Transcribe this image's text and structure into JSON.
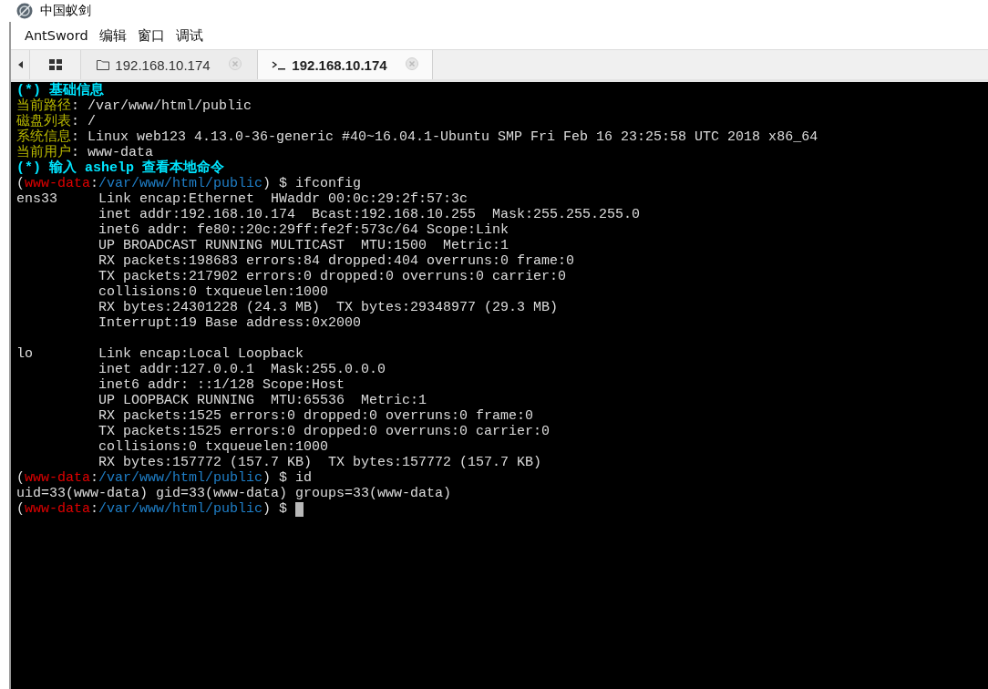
{
  "window": {
    "title": "中国蚁剑"
  },
  "menu": [
    "AntSword",
    "编辑",
    "窗口",
    "调试"
  ],
  "tabs": [
    {
      "kind": "files",
      "label": "192.168.10.174",
      "selected": false
    },
    {
      "kind": "terminal",
      "label": "192.168.10.174",
      "selected": true
    }
  ],
  "terminal": {
    "lines": [
      {
        "cursor": false,
        "segments": [
          {
            "kind": "heading",
            "text": "(*) 基础信息"
          }
        ]
      },
      {
        "cursor": false,
        "segments": [
          {
            "kind": "label",
            "text": "当前路径"
          },
          {
            "kind": "plain",
            "text": ": /var/www/html/public"
          }
        ]
      },
      {
        "cursor": false,
        "segments": [
          {
            "kind": "label",
            "text": "磁盘列表"
          },
          {
            "kind": "plain",
            "text": ": /"
          }
        ]
      },
      {
        "cursor": false,
        "segments": [
          {
            "kind": "label",
            "text": "系统信息"
          },
          {
            "kind": "plain",
            "text": ": Linux web123 4.13.0-36-generic #40~16.04.1-Ubuntu SMP Fri Feb 16 23:25:58 UTC 2018 x86_64"
          }
        ]
      },
      {
        "cursor": false,
        "segments": [
          {
            "kind": "label",
            "text": "当前用户"
          },
          {
            "kind": "plain",
            "text": ": www-data"
          }
        ]
      },
      {
        "cursor": false,
        "segments": [
          {
            "kind": "heading",
            "text": "(*) 输入 ashelp 查看本地命令"
          }
        ]
      },
      {
        "cursor": false,
        "segments": [
          {
            "kind": "plain",
            "text": "("
          },
          {
            "kind": "user",
            "text": "www-data"
          },
          {
            "kind": "plain",
            "text": ":"
          },
          {
            "kind": "path",
            "text": "/var/www/html/public"
          },
          {
            "kind": "plain",
            "text": ") $ ifconfig"
          }
        ]
      },
      {
        "cursor": false,
        "segments": [
          {
            "kind": "plain",
            "text": "ens33     Link encap:Ethernet  HWaddr 00:0c:29:2f:57:3c"
          }
        ]
      },
      {
        "cursor": false,
        "segments": [
          {
            "kind": "plain",
            "text": "          inet addr:192.168.10.174  Bcast:192.168.10.255  Mask:255.255.255.0"
          }
        ]
      },
      {
        "cursor": false,
        "segments": [
          {
            "kind": "plain",
            "text": "          inet6 addr: fe80::20c:29ff:fe2f:573c/64 Scope:Link"
          }
        ]
      },
      {
        "cursor": false,
        "segments": [
          {
            "kind": "plain",
            "text": "          UP BROADCAST RUNNING MULTICAST  MTU:1500  Metric:1"
          }
        ]
      },
      {
        "cursor": false,
        "segments": [
          {
            "kind": "plain",
            "text": "          RX packets:198683 errors:84 dropped:404 overruns:0 frame:0"
          }
        ]
      },
      {
        "cursor": false,
        "segments": [
          {
            "kind": "plain",
            "text": "          TX packets:217902 errors:0 dropped:0 overruns:0 carrier:0"
          }
        ]
      },
      {
        "cursor": false,
        "segments": [
          {
            "kind": "plain",
            "text": "          collisions:0 txqueuelen:1000"
          }
        ]
      },
      {
        "cursor": false,
        "segments": [
          {
            "kind": "plain",
            "text": "          RX bytes:24301228 (24.3 MB)  TX bytes:29348977 (29.3 MB)"
          }
        ]
      },
      {
        "cursor": false,
        "segments": [
          {
            "kind": "plain",
            "text": "          Interrupt:19 Base address:0x2000"
          }
        ]
      },
      {
        "cursor": false
      },
      {
        "cursor": false,
        "segments": [
          {
            "kind": "plain",
            "text": "lo        Link encap:Local Loopback"
          }
        ]
      },
      {
        "cursor": false,
        "segments": [
          {
            "kind": "plain",
            "text": "          inet addr:127.0.0.1  Mask:255.0.0.0"
          }
        ]
      },
      {
        "cursor": false,
        "segments": [
          {
            "kind": "plain",
            "text": "          inet6 addr: ::1/128 Scope:Host"
          }
        ]
      },
      {
        "cursor": false,
        "segments": [
          {
            "kind": "plain",
            "text": "          UP LOOPBACK RUNNING  MTU:65536  Metric:1"
          }
        ]
      },
      {
        "cursor": false,
        "segments": [
          {
            "kind": "plain",
            "text": "          RX packets:1525 errors:0 dropped:0 overruns:0 frame:0"
          }
        ]
      },
      {
        "cursor": false,
        "segments": [
          {
            "kind": "plain",
            "text": "          TX packets:1525 errors:0 dropped:0 overruns:0 carrier:0"
          }
        ]
      },
      {
        "cursor": false,
        "segments": [
          {
            "kind": "plain",
            "text": "          collisions:0 txqueuelen:1000"
          }
        ]
      },
      {
        "cursor": false,
        "segments": [
          {
            "kind": "plain",
            "text": "          RX bytes:157772 (157.7 KB)  TX bytes:157772 (157.7 KB)"
          }
        ]
      },
      {
        "cursor": false,
        "segments": [
          {
            "kind": "plain",
            "text": "("
          },
          {
            "kind": "user",
            "text": "www-data"
          },
          {
            "kind": "plain",
            "text": ":"
          },
          {
            "kind": "path",
            "text": "/var/www/html/public"
          },
          {
            "kind": "plain",
            "text": ") $ id"
          }
        ]
      },
      {
        "cursor": false,
        "segments": [
          {
            "kind": "plain",
            "text": "uid=33(www-data) gid=33(www-data) groups=33(www-data)"
          }
        ]
      },
      {
        "cursor": true,
        "segments": [
          {
            "kind": "plain",
            "text": "("
          },
          {
            "kind": "user",
            "text": "www-data"
          },
          {
            "kind": "plain",
            "text": ":"
          },
          {
            "kind": "path",
            "text": "/var/www/html/public"
          },
          {
            "kind": "plain",
            "text": ") $ "
          }
        ]
      }
    ]
  }
}
